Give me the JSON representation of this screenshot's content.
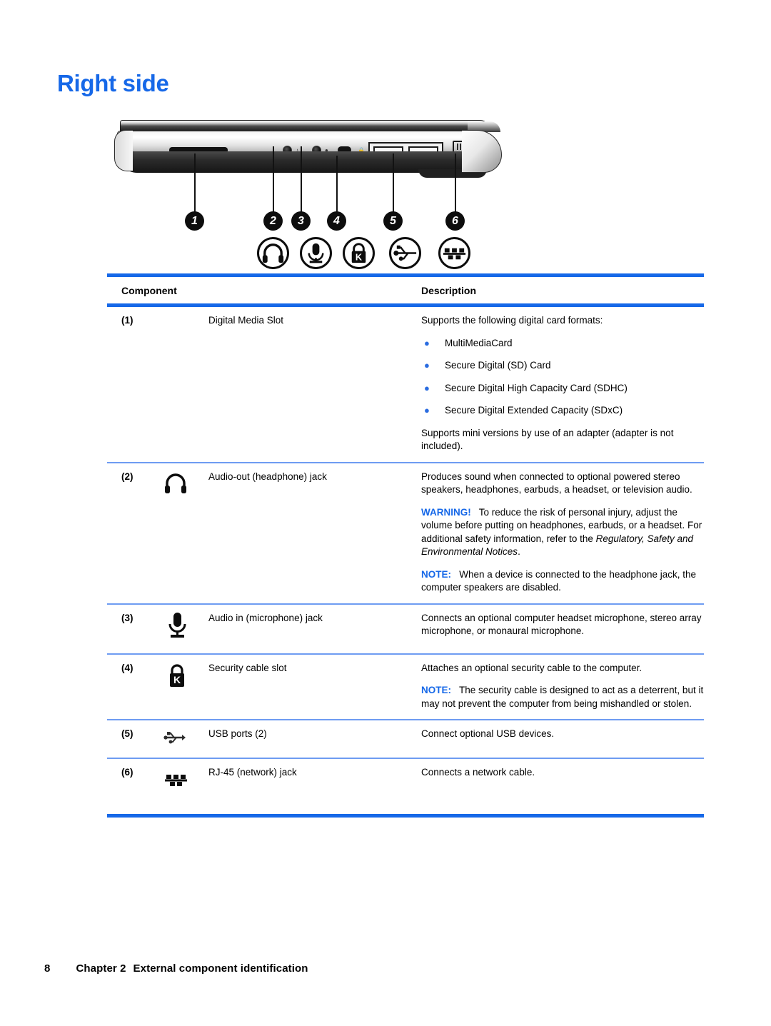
{
  "page": {
    "title": "Right side",
    "footer": {
      "page_number": "8",
      "chapter": "Chapter 2",
      "chapter_title": "External component identification"
    }
  },
  "figure": {
    "caption_numbers": [
      "1",
      "2",
      "3",
      "4",
      "5",
      "6"
    ],
    "icons": [
      {
        "name": "headphone-icon",
        "for": "2"
      },
      {
        "name": "microphone-icon",
        "for": "3"
      },
      {
        "name": "lock-icon",
        "for": "4"
      },
      {
        "name": "usb-icon",
        "for": "5"
      },
      {
        "name": "rj45-icon",
        "for": "6"
      }
    ]
  },
  "table": {
    "headers": {
      "component": "Component",
      "description": "Description"
    },
    "rows": [
      {
        "num": "(1)",
        "icon": "none",
        "name": "Digital Media Slot",
        "desc_intro": "Supports the following digital card formats:",
        "bullets": [
          "MultiMediaCard",
          "Secure Digital (SD) Card",
          "Secure Digital High Capacity Card (SDHC)",
          "Secure Digital Extended Capacity (SDxC)"
        ],
        "desc_outro": "Supports mini versions by use of an adapter (adapter is not included)."
      },
      {
        "num": "(2)",
        "icon": "headphone-icon",
        "name": "Audio-out (headphone) jack",
        "desc_p1": "Produces sound when connected to optional powered stereo speakers, headphones, earbuds, a headset, or television audio.",
        "warning_label": "WARNING!",
        "warning_text": "To reduce the risk of personal injury, adjust the volume before putting on headphones, earbuds, or a headset. For additional safety information, refer to the",
        "warning_italic": "Regulatory, Safety and Environmental Notices",
        "warning_tail": ".",
        "note_label": "NOTE:",
        "note_text": "When a device is connected to the headphone jack, the computer speakers are disabled."
      },
      {
        "num": "(3)",
        "icon": "microphone-icon",
        "name": "Audio in (microphone) jack",
        "desc_p1": "Connects an optional computer headset microphone, stereo array microphone, or monaural microphone."
      },
      {
        "num": "(4)",
        "icon": "lock-icon",
        "name": "Security cable slot",
        "desc_p1": "Attaches an optional security cable to the computer.",
        "note_label": "NOTE:",
        "note_text": "The security cable is designed to act as a deterrent, but it may not prevent the computer from being mishandled or stolen."
      },
      {
        "num": "(5)",
        "icon": "usb-icon",
        "name": "USB ports (2)",
        "desc_p1": "Connect optional USB devices."
      },
      {
        "num": "(6)",
        "icon": "rj45-icon",
        "name": "RJ-45 (network) jack",
        "desc_p1": "Connects a network cable."
      }
    ]
  },
  "colors": {
    "heading_blue": "#1668e8",
    "rule_blue": "#1668e8",
    "rule_light_blue": "#6e9cf2",
    "bullet_blue": "#2a6ce0"
  }
}
